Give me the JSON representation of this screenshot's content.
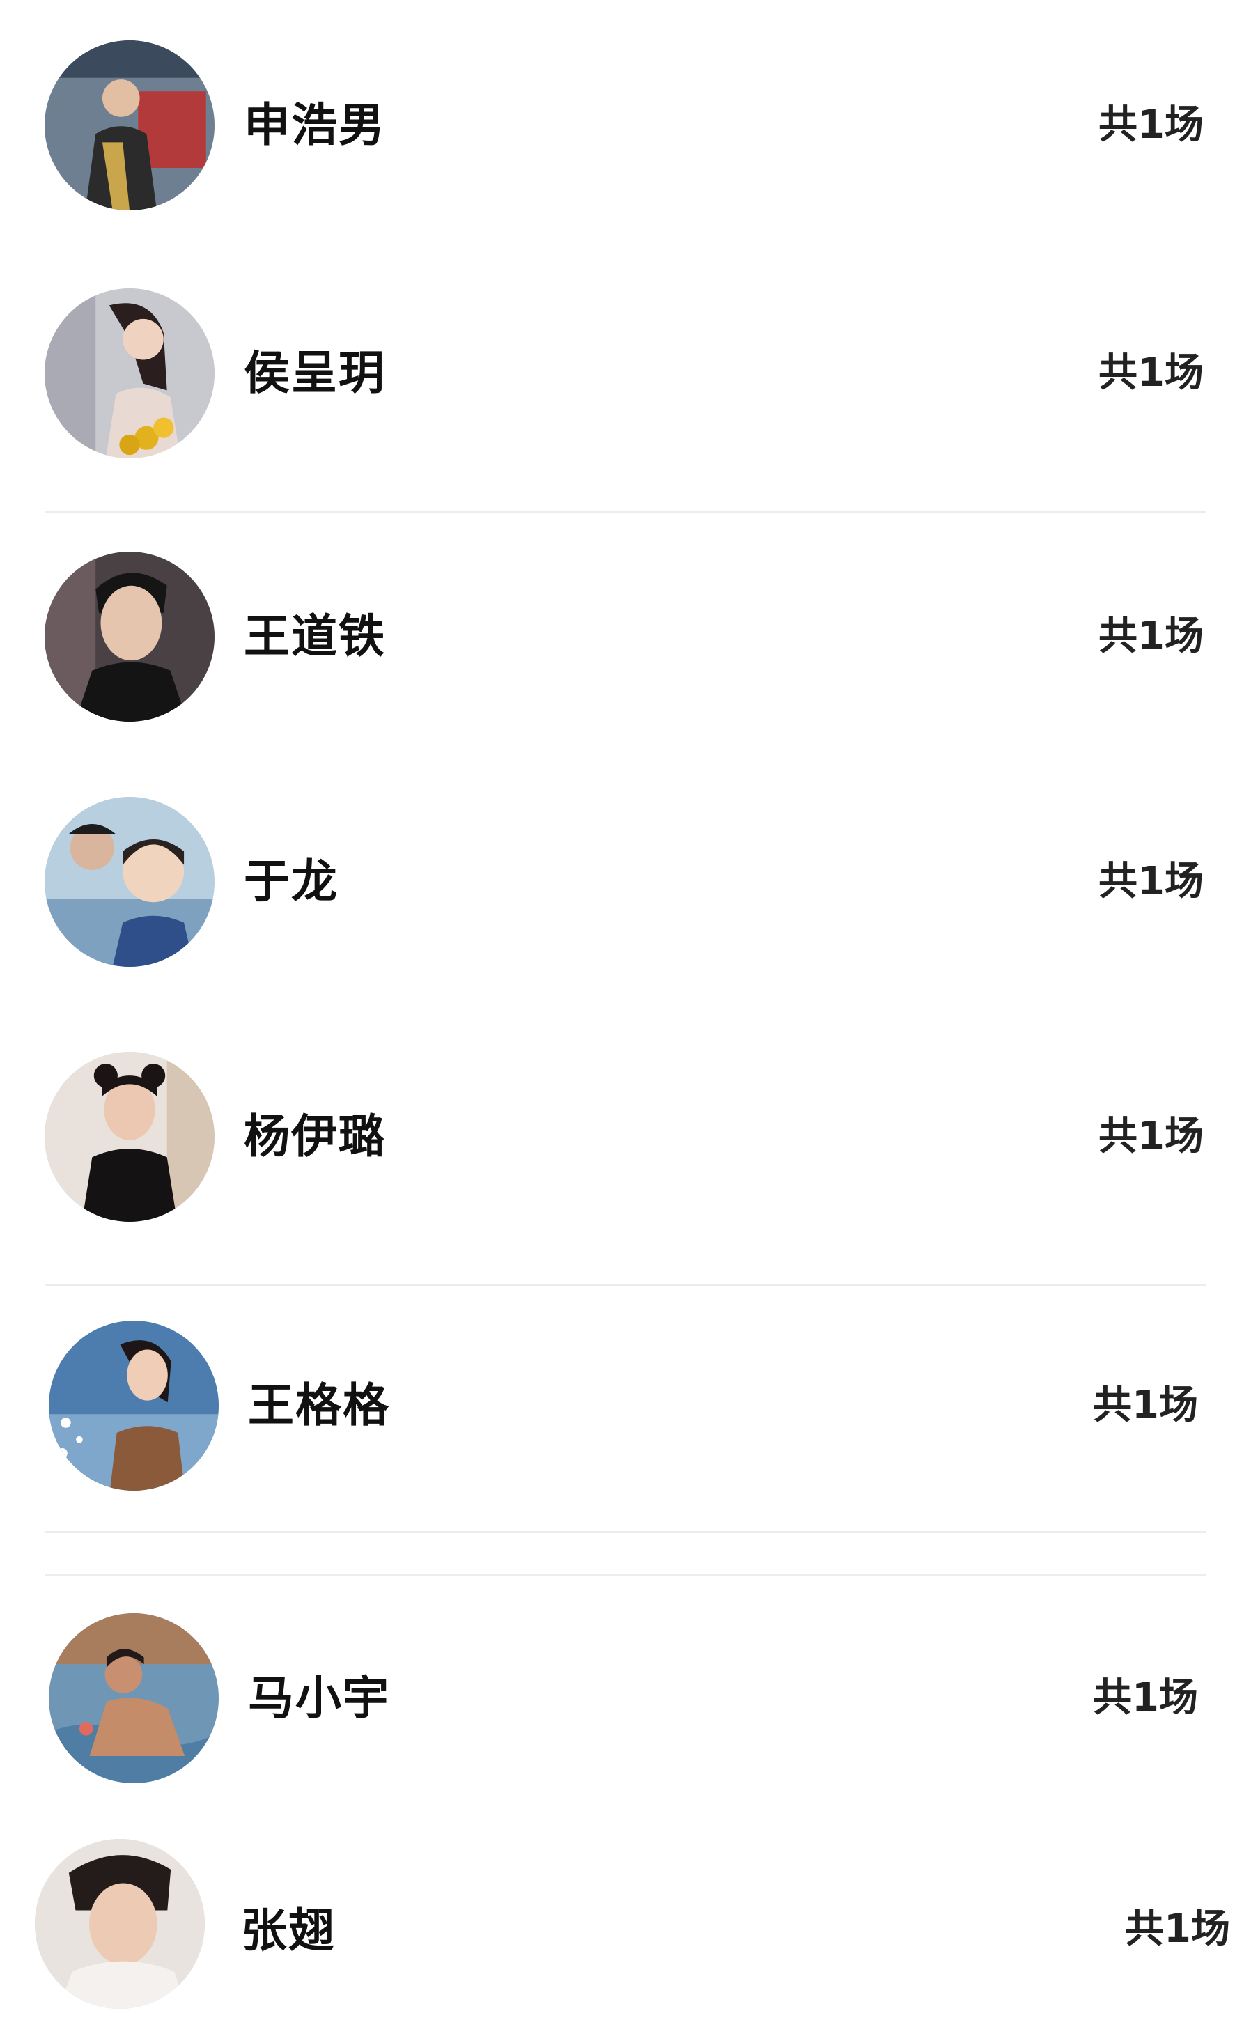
{
  "performers": [
    {
      "name": "申浩男",
      "count": "共1场",
      "avatar_icon": "man-in-jacket-photo"
    },
    {
      "name": "侯呈玥",
      "count": "共1场",
      "avatar_icon": "woman-with-flowers-photo"
    },
    {
      "name": "王道铁",
      "count": "共1场",
      "avatar_icon": "man-portrait-photo"
    },
    {
      "name": "于龙",
      "count": "共1场",
      "avatar_icon": "couple-selfie-photo"
    },
    {
      "name": "杨伊璐",
      "count": "共1场",
      "avatar_icon": "woman-black-top-photo"
    },
    {
      "name": "王格格",
      "count": "共1场",
      "avatar_icon": "woman-by-water-photo"
    },
    {
      "name": "马小宇",
      "count": "共1场",
      "avatar_icon": "man-in-pool-photo"
    },
    {
      "name": "张翅",
      "count": "共1场",
      "avatar_icon": "man-close-up-photo"
    }
  ],
  "colors": {
    "background": "#ffffff",
    "text": "#111111",
    "divider": "#ededed"
  }
}
